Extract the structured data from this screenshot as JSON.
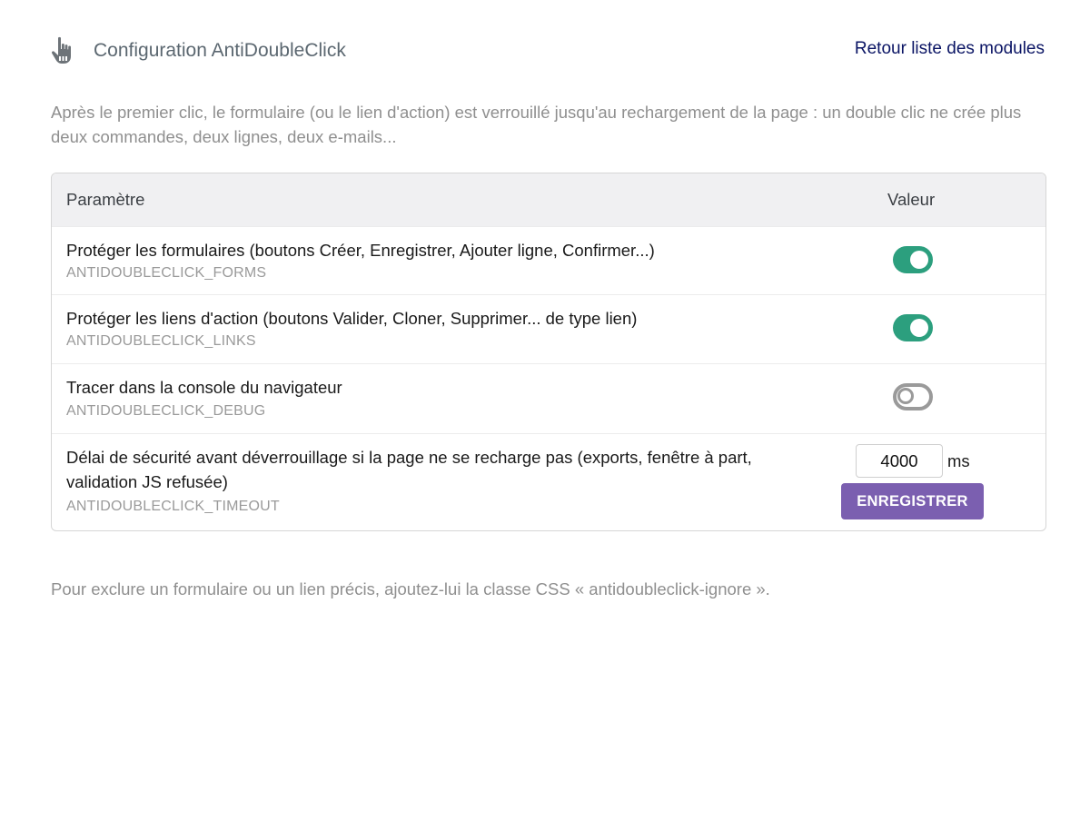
{
  "header": {
    "icon": "pointing-hand-icon",
    "title": "Configuration AntiDoubleClick",
    "back_link": "Retour liste des modules"
  },
  "intro": "Après le premier clic, le formulaire (ou le lien d'action) est verrouillé jusqu'au rechargement de la page : un double clic ne crée plus deux commandes, deux lignes, deux e-mails...",
  "table": {
    "headers": {
      "param": "Paramètre",
      "value": "Valeur"
    },
    "rows": [
      {
        "label": "Protéger les formulaires (boutons Créer, Enregistrer, Ajouter ligne, Confirmer...)",
        "code": "ANTIDOUBLECLICK_FORMS",
        "enabled": true
      },
      {
        "label": "Protéger les liens d'action (boutons Valider, Cloner, Supprimer... de type lien)",
        "code": "ANTIDOUBLECLICK_LINKS",
        "enabled": true
      },
      {
        "label": "Tracer dans la console du navigateur",
        "code": "ANTIDOUBLECLICK_DEBUG",
        "enabled": false
      }
    ],
    "timeout_row": {
      "label": "Délai de sécurité avant déverrouillage si la page ne se recharge pas (exports, fenêtre à part, validation JS refusée)",
      "code": "ANTIDOUBLECLICK_TIMEOUT",
      "value": "4000",
      "unit": "ms",
      "save_label": "ENREGISTRER"
    }
  },
  "footer_note": "Pour exclure un formulaire ou un lien précis, ajoutez-lui la classe CSS « antidoubleclick-ignore ».",
  "colors": {
    "toggle_on": "#2c9f7e",
    "toggle_off": "#9a9a9a",
    "button": "#7b5fb0",
    "link": "#0a1464"
  }
}
